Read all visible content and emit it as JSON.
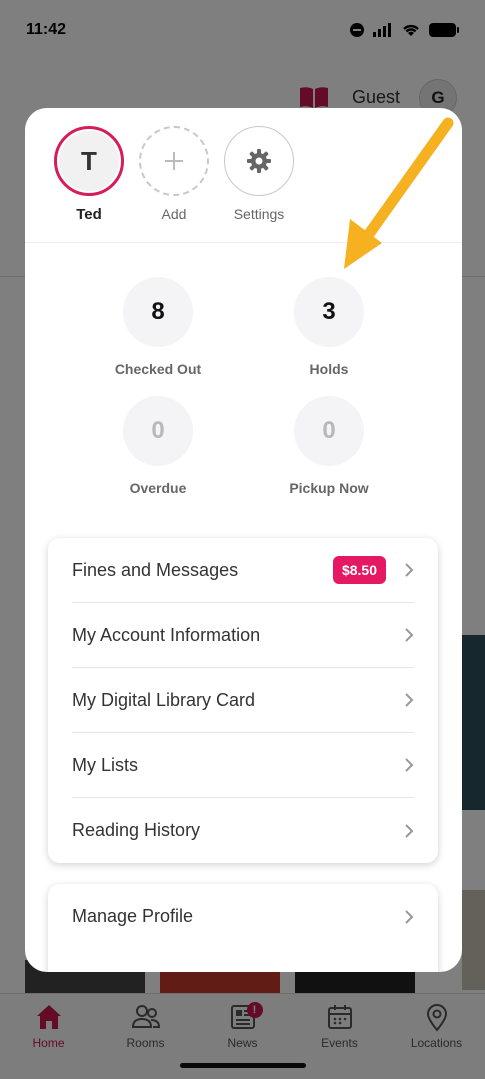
{
  "status_bar": {
    "time": "11:42"
  },
  "header": {
    "user_label": "Guest",
    "avatar_initial": "G"
  },
  "profiles": [
    {
      "initial": "T",
      "name": "Ted"
    },
    {
      "name": "Add"
    },
    {
      "name": "Settings"
    }
  ],
  "stats": [
    {
      "value": "8",
      "label": "Checked Out"
    },
    {
      "value": "3",
      "label": "Holds"
    },
    {
      "value": "0",
      "label": "Overdue"
    },
    {
      "value": "0",
      "label": "Pickup Now"
    }
  ],
  "account_menu": [
    {
      "label": "Fines and Messages",
      "badge": "$8.50"
    },
    {
      "label": "My Account Information"
    },
    {
      "label": "My Digital Library Card"
    },
    {
      "label": "My Lists"
    },
    {
      "label": "Reading History"
    }
  ],
  "profile_menu": [
    {
      "label": "Manage Profile"
    }
  ],
  "tabs": [
    {
      "label": "Home",
      "active": true
    },
    {
      "label": "Rooms"
    },
    {
      "label": "News",
      "badge": "!"
    },
    {
      "label": "Events"
    },
    {
      "label": "Locations"
    }
  ],
  "colors": {
    "accent": "#d81b5a",
    "badge": "#e51863",
    "arrow": "#f5b120"
  },
  "icons": [
    "book-icon",
    "plus-icon",
    "gear-icon",
    "chevron-right-icon",
    "home-icon",
    "people-icon",
    "news-icon",
    "calendar-icon",
    "location-pin-icon",
    "arrow-annotation"
  ]
}
